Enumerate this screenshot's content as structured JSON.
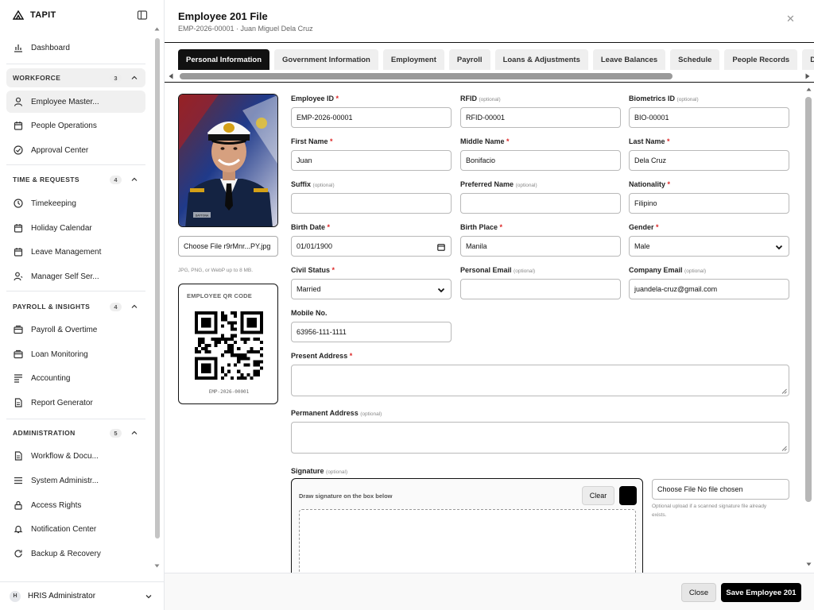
{
  "sidebar": {
    "brand": "TAPIT",
    "dashboard": "Dashboard",
    "sections": [
      {
        "title": "WORKFORCE",
        "count": "3",
        "items": [
          "Employee Master...",
          "People Operations",
          "Approval Center"
        ]
      },
      {
        "title": "TIME & REQUESTS",
        "count": "4",
        "items": [
          "Timekeeping",
          "Holiday Calendar",
          "Leave Management",
          "Manager Self Ser..."
        ]
      },
      {
        "title": "PAYROLL & INSIGHTS",
        "count": "4",
        "items": [
          "Payroll & Overtime",
          "Loan Monitoring",
          "Accounting",
          "Report Generator"
        ]
      },
      {
        "title": "ADMINISTRATION",
        "count": "5",
        "items": [
          "Workflow & Docu...",
          "System Administr...",
          "Access Rights",
          "Notification Center",
          "Backup & Recovery"
        ]
      }
    ],
    "user": {
      "initial": "H",
      "name": "HRIS Administrator"
    }
  },
  "header": {
    "title": "Employee 201 File",
    "subtitle": "EMP-2026-00001 · Juan Miguel Dela Cruz"
  },
  "tabs": [
    "Personal Information",
    "Government Information",
    "Employment",
    "Payroll",
    "Loans & Adjustments",
    "Leave Balances",
    "Schedule",
    "People Records",
    "Docu"
  ],
  "photo": {
    "file_label": "Choose File r9rMnr...PY.jpg",
    "hint": "JPG, PNG, or WebP up to 8 MB.",
    "badge": "DAYTONA"
  },
  "qr": {
    "title": "EMPLOYEE QR CODE",
    "id": "EMP-2026-00001"
  },
  "form": {
    "required_mark": "*",
    "optional_mark": "(optional)",
    "employee_id": {
      "label": "Employee ID",
      "value": "EMP-2026-00001"
    },
    "rfid": {
      "label": "RFID",
      "value": "RFID-00001"
    },
    "biometrics_id": {
      "label": "Biometrics ID",
      "value": "BIO-00001"
    },
    "first_name": {
      "label": "First Name",
      "value": "Juan"
    },
    "middle_name": {
      "label": "Middle Name",
      "value": "Bonifacio"
    },
    "last_name": {
      "label": "Last Name",
      "value": "Dela Cruz"
    },
    "suffix": {
      "label": "Suffix",
      "value": ""
    },
    "preferred_name": {
      "label": "Preferred Name",
      "value": ""
    },
    "nationality": {
      "label": "Nationality",
      "value": "Filipino"
    },
    "birth_date": {
      "label": "Birth Date",
      "value": "01/01/1900"
    },
    "birth_place": {
      "label": "Birth Place",
      "value": "Manila"
    },
    "gender": {
      "label": "Gender",
      "value": "Male"
    },
    "civil_status": {
      "label": "Civil Status",
      "value": "Married"
    },
    "personal_email": {
      "label": "Personal Email",
      "value": ""
    },
    "company_email": {
      "label": "Company Email",
      "value": "juandela-cruz@gmail.com"
    },
    "mobile": {
      "label": "Mobile No.",
      "value": "63956-111-1111"
    },
    "present_address": {
      "label": "Present Address"
    },
    "permanent_address": {
      "label": "Permanent Address"
    },
    "signature": {
      "label": "Signature",
      "draw_label": "Draw signature on the box below",
      "clear": "Clear",
      "file_label": "Choose File No file chosen",
      "hint_1": "Optional upload if a scanned signature file already",
      "hint_2": "exists."
    }
  },
  "footer": {
    "close": "Close",
    "save": "Save Employee 201"
  }
}
